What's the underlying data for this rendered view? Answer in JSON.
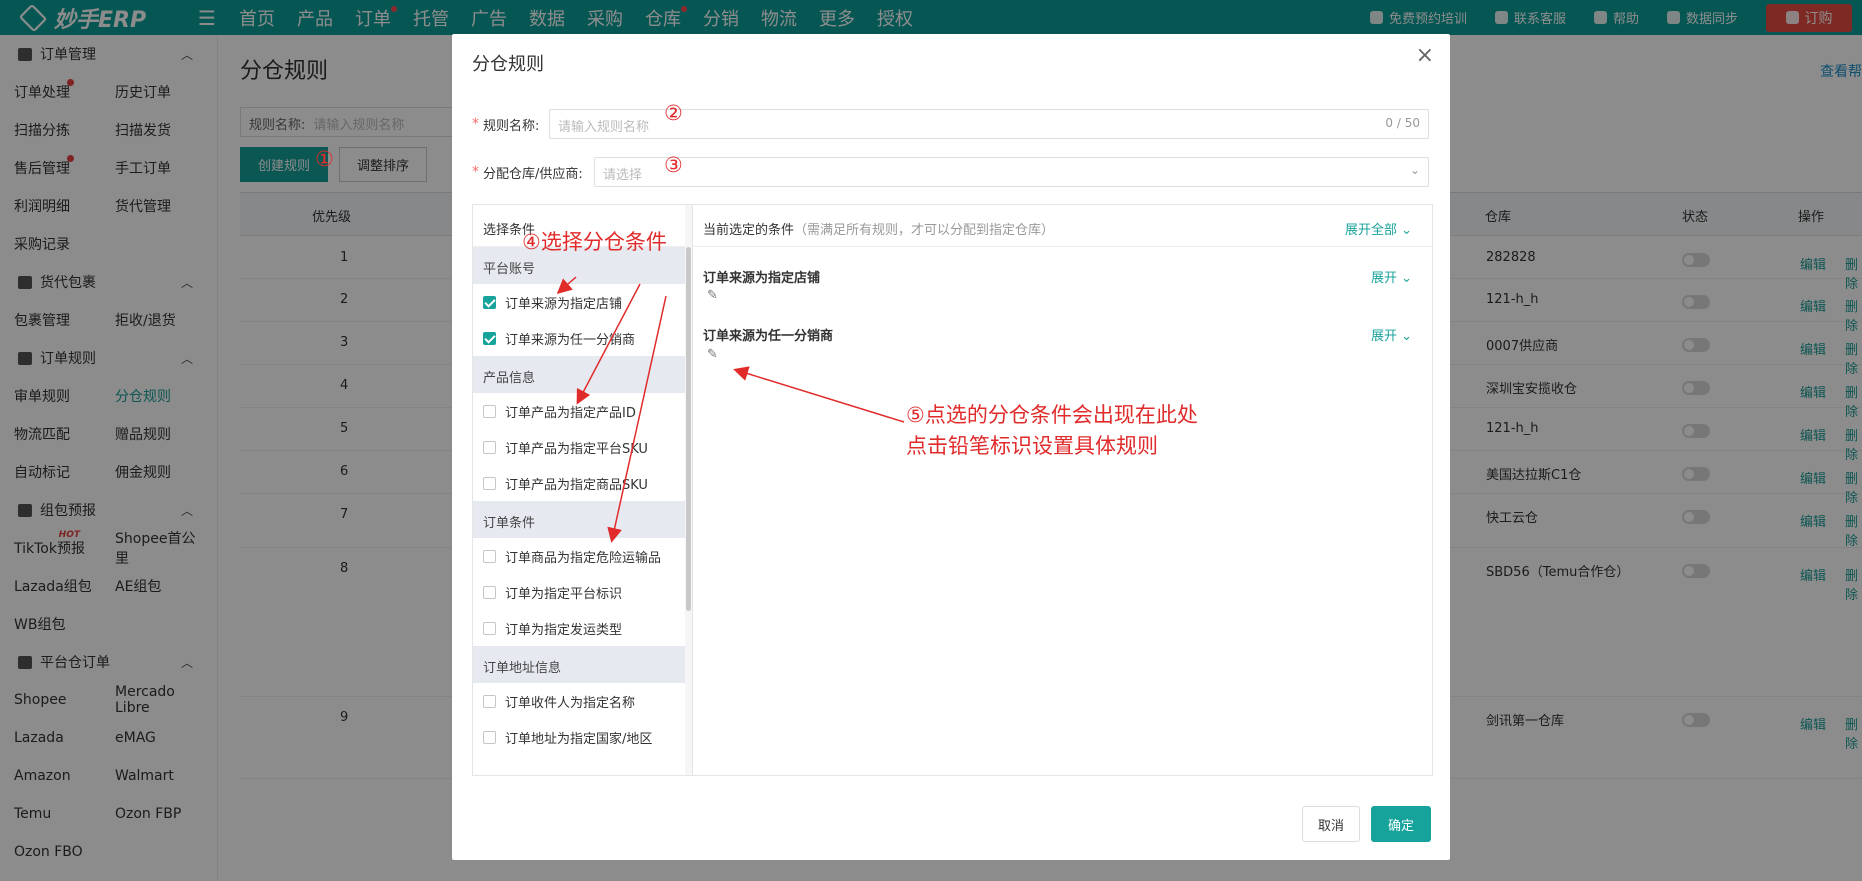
{
  "app": {
    "brand": "妙手ERP",
    "accent": "#0c9f9a",
    "annotation_color": "#e12b2b"
  },
  "top_nav": [
    "首页",
    "产品",
    "订单",
    "托管",
    "广告",
    "数据",
    "采购",
    "仓库",
    "分销",
    "物流",
    "更多",
    "授权"
  ],
  "top_right": {
    "training": "免费预约培训",
    "service": "联系客服",
    "help": "帮助",
    "sync": "数据同步",
    "buy": "订购"
  },
  "sidebar": {
    "sections": [
      {
        "title": "订单管理",
        "rows": [
          [
            "订单处理",
            "历史订单"
          ],
          [
            "扫描分拣",
            "扫描发货"
          ],
          [
            "售后管理",
            "手工订单"
          ],
          [
            "利润明细",
            "货代管理"
          ],
          [
            "采购记录",
            ""
          ]
        ]
      },
      {
        "title": "货代包裹",
        "rows": [
          [
            "包裹管理",
            "拒收/退货"
          ]
        ]
      },
      {
        "title": "订单规则",
        "rows": [
          [
            "审单规则",
            "分仓规则"
          ],
          [
            "物流匹配",
            "赠品规则"
          ],
          [
            "自动标记",
            "佣金规则"
          ]
        ]
      },
      {
        "title": "组包预报",
        "rows": [
          [
            "TikTok预报",
            "Shopee首公里"
          ],
          [
            "Lazada组包",
            "AE组包"
          ],
          [
            "WB组包",
            ""
          ]
        ]
      },
      {
        "title": "平台仓订单",
        "rows": [
          [
            "Shopee",
            "Mercado Libre"
          ],
          [
            "Lazada",
            "eMAG"
          ],
          [
            "Amazon",
            "Walmart"
          ],
          [
            "Temu",
            "Ozon FBP"
          ],
          [
            "Ozon FBO",
            ""
          ]
        ]
      }
    ],
    "hot_label": "HOT"
  },
  "page": {
    "title": "分仓规则",
    "help": "查看帮",
    "search_label": "规则名称:",
    "search_placeholder": "请输入规则名称",
    "create_btn": "创建规则",
    "reorder_btn": "调整排序"
  },
  "table": {
    "headers": {
      "priority": "优先级",
      "warehouse": "仓库",
      "status": "状态",
      "action": "操作"
    },
    "rows": [
      {
        "n": "1",
        "wh": "282828"
      },
      {
        "n": "2",
        "wh": "121-h_h"
      },
      {
        "n": "3",
        "wh": "0007供应商"
      },
      {
        "n": "4",
        "wh": "深圳宝安揽收仓"
      },
      {
        "n": "5",
        "wh": "121-h_h"
      },
      {
        "n": "6",
        "wh": "美国达拉斯C1仓"
      },
      {
        "n": "7",
        "wh": "快工云仓"
      },
      {
        "n": "8",
        "wh": "SBD56（Temu合作仓）"
      },
      {
        "n": "9",
        "wh": "剑讯第一仓库"
      }
    ],
    "edit": "编辑",
    "delete": "删除"
  },
  "modal": {
    "title": "分仓规则",
    "rule_name_label": "规则名称:",
    "rule_name_placeholder": "请输入规则名称",
    "counter": "0 / 50",
    "warehouse_label": "分配仓库/供应商:",
    "warehouse_placeholder": "请选择",
    "cond_header": "选择条件",
    "groups": [
      {
        "name": "平台账号",
        "items": [
          {
            "label": "订单来源为指定店铺",
            "checked": true
          },
          {
            "label": "订单来源为任一分销商",
            "checked": true
          }
        ]
      },
      {
        "name": "产品信息",
        "items": [
          {
            "label": "订单产品为指定产品ID",
            "checked": false
          },
          {
            "label": "订单产品为指定平台SKU",
            "checked": false
          },
          {
            "label": "订单产品为指定商品SKU",
            "checked": false
          }
        ]
      },
      {
        "name": "订单条件",
        "items": [
          {
            "label": "订单商品为指定危险运输品",
            "checked": false
          },
          {
            "label": "订单为指定平台标识",
            "checked": false
          },
          {
            "label": "订单为指定发运类型",
            "checked": false
          }
        ]
      },
      {
        "name": "订单地址信息",
        "items": [
          {
            "label": "订单收件人为指定名称",
            "checked": false
          },
          {
            "label": "订单地址为指定国家/地区",
            "checked": false
          }
        ]
      }
    ],
    "selected_header": "当前选定的条件",
    "selected_note": "（需满足所有规则，才可以分配到指定仓库）",
    "expand_all": "展开全部",
    "selected": [
      {
        "title": "订单来源为指定店铺",
        "expand": "展开"
      },
      {
        "title": "订单来源为任一分销商",
        "expand": "展开"
      }
    ],
    "cancel": "取消",
    "confirm": "确定"
  },
  "annotations": {
    "a1": "①",
    "a2": "②",
    "a3": "③",
    "a4": "④选择分仓条件",
    "a5_line1": "⑤点选的分仓条件会出现在此处",
    "a5_line2": "点击铅笔标识设置具体规则"
  }
}
